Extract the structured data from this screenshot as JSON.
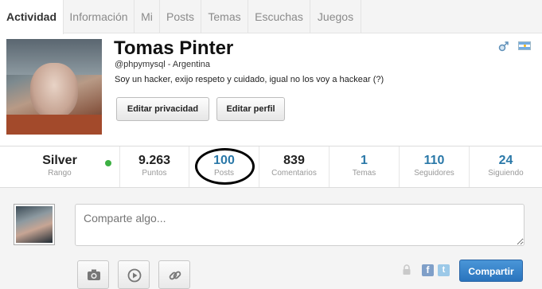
{
  "tabs": [
    {
      "label": "Actividad"
    },
    {
      "label": "Información"
    },
    {
      "label": "Mi"
    },
    {
      "label": "Posts"
    },
    {
      "label": "Temas"
    },
    {
      "label": "Escuchas"
    },
    {
      "label": "Juegos"
    }
  ],
  "active_tab": "Actividad",
  "profile": {
    "name": "Tomas Pinter",
    "handle": "@phpymysql - Argentina",
    "bio": "Soy un hacker, exijo respeto y cuidado, igual no los voy a hackear (?)",
    "gender_icon": "male-icon",
    "country_flag": "argentina-flag-icon",
    "buttons": {
      "privacy": "Editar privacidad",
      "profile": "Editar perfil"
    }
  },
  "stats": [
    {
      "value": "Silver",
      "label": "Rango"
    },
    {
      "value": "9.263",
      "label": "Puntos"
    },
    {
      "value": "100",
      "label": "Posts"
    },
    {
      "value": "839",
      "label": "Comentarios"
    },
    {
      "value": "1",
      "label": "Temas"
    },
    {
      "value": "110",
      "label": "Seguidores"
    },
    {
      "value": "24",
      "label": "Siguiendo"
    }
  ],
  "status": {
    "online_color": "#3cb043"
  },
  "annotation": {
    "circled_stat": "Posts",
    "color": "#000000"
  },
  "composer": {
    "placeholder": "Comparte algo...",
    "share_label": "Compartir",
    "tools": [
      "camera-icon",
      "play-icon",
      "link-icon"
    ],
    "social_icons": [
      "lock-icon",
      "facebook-icon",
      "twitter-icon"
    ]
  },
  "colors": {
    "accent_blue": "#2a78a8",
    "share_button": "#2a74bd"
  }
}
